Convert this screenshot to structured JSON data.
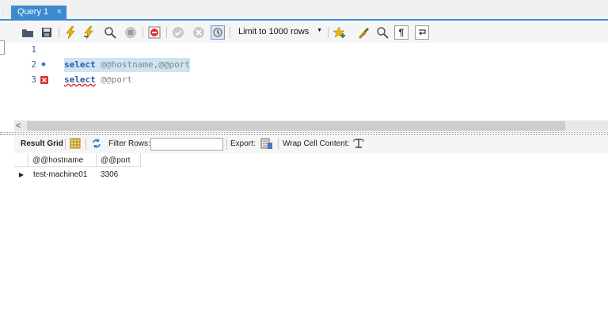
{
  "tabs": [
    {
      "label": "Query 1",
      "close": "×"
    }
  ],
  "toolbar": {
    "limit_select": {
      "value": "Limit to 1000 rows"
    },
    "icons": [
      "open-folder-icon",
      "save-icon",
      "execute-icon",
      "execute-current-icon",
      "explain-icon",
      "stop-icon",
      "toggle-continue-on-error-icon",
      "commit-icon",
      "rollback-icon",
      "autocommit-icon",
      "add-snippet-icon",
      "beautify-icon",
      "find-icon",
      "invisible-chars-icon",
      "wrap-icon"
    ]
  },
  "editor": {
    "lines": [
      {
        "num": "1",
        "keyword": "",
        "rest": ""
      },
      {
        "num": "2",
        "keyword": "select",
        "rest": "@@hostname,@@port"
      },
      {
        "num": "3",
        "keyword": "select",
        "rest": "@@port"
      }
    ]
  },
  "results_toolbar": {
    "result_grid": "Result Grid",
    "filter_rows": "Filter Rows:",
    "filter_value": "",
    "export": "Export:",
    "wrap_cell": "Wrap Cell Content:"
  },
  "grid": {
    "columns": [
      "@@hostname",
      "@@port"
    ],
    "rows": [
      [
        "test-machine01",
        "3306"
      ]
    ]
  },
  "colors": {
    "accent": "#3c8ad0",
    "keyword": "#2a5d9d",
    "error": "#d00000"
  }
}
